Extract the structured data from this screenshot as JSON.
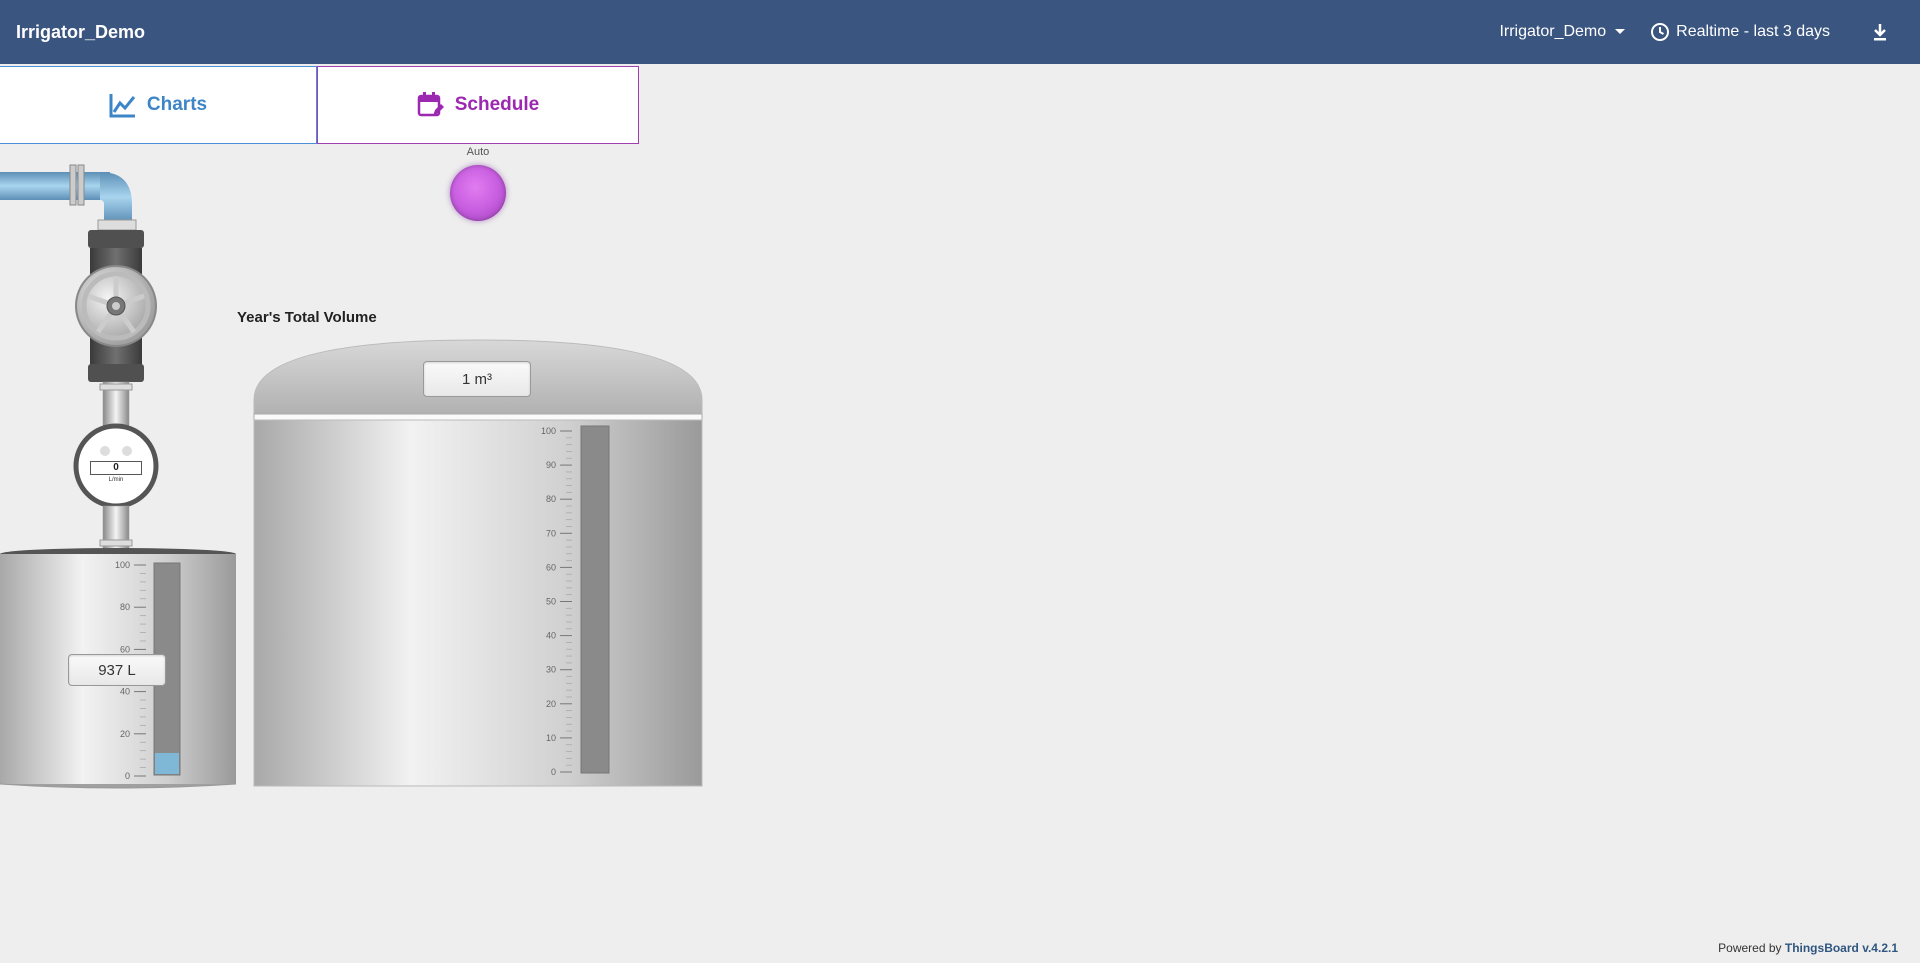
{
  "header": {
    "title": "Irrigator_Demo",
    "entity_label": "Irrigator_Demo",
    "time_window": "Realtime - last 3 days"
  },
  "tabs": {
    "charts_label": "Charts",
    "schedule_label": "Schedule"
  },
  "auto_indicator": {
    "label": "Auto",
    "color": "#c85ee0"
  },
  "small_tank": {
    "value": "937 L",
    "scale_ticks": [
      "100",
      "80",
      "60",
      "40",
      "20",
      "0"
    ],
    "fill_percent": 10
  },
  "flow_meter": {
    "value": "0",
    "unit": "L/min"
  },
  "volume_tank": {
    "title": "Year's Total Volume",
    "value": "1 m³",
    "scale_ticks": [
      "100",
      "90",
      "80",
      "70",
      "60",
      "50",
      "40",
      "30",
      "20",
      "10",
      "0"
    ],
    "fill_percent": 0
  },
  "footer": {
    "prefix": "Powered by ",
    "brand": "ThingsBoard v.4.2.1"
  },
  "colors": {
    "header_bg": "#3a5580",
    "charts_accent": "#3d85c6",
    "schedule_accent": "#9c27b0",
    "water": "#7fb7d6"
  }
}
